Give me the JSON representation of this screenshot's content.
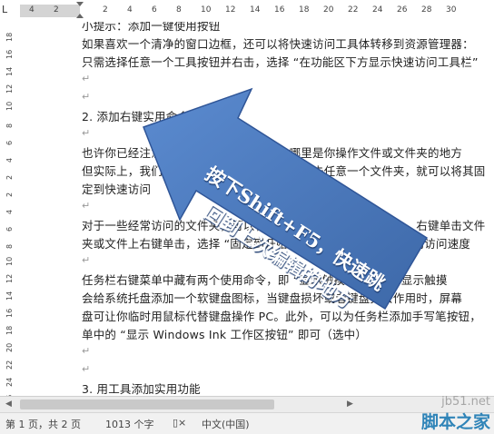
{
  "ruler": {
    "corner": "L",
    "top_numbers": [
      "4",
      "2",
      "",
      "2",
      "4",
      "6",
      "8",
      "10",
      "12",
      "14",
      "16",
      "18",
      "20",
      "22",
      "24",
      "26",
      "28",
      "30"
    ],
    "left_numbers": [
      "18",
      "16",
      "14",
      "12",
      "10",
      "8",
      "6",
      "4",
      "2",
      "2",
      "4",
      "6",
      "8",
      "10",
      "12",
      "14",
      "16",
      "18",
      "20",
      "22",
      "24",
      "26",
      "28",
      "30",
      "32",
      "34"
    ]
  },
  "document": {
    "lines": [
      "小提示：添加一键使用按钮",
      "如果喜欢一个清净的窗口边框，还可以将快速访问工具体转移到资源管理器：",
      "只需选择任意一个工具按钮并右击，选择 “在功能区下方显示快速访问工具栏”",
      "",
      "",
      "2. 添加右键实用命令",
      "",
      "也许你已经注意到了这个快速访问菜单，哪里是你操作文件或文件夹的地方",
      "但实际上，我们可以将它固定在这里。右键单击任意一个文件夹，就可以将其固",
      "定到快速访问",
      "",
      "对于一些经常访问的文件夹，可以将它们添加到开始屏幕菜单中。右键单击文件",
      "夹或文件上右键单击，选择 “固定到开始屏幕” 以增加常用文件夹的访问速度",
      "",
      "任务栏右键菜单中藏有两个使用命令，即 “显示触摸键盘按钮” 显示触摸",
      "会给系统托盘添加一个软键盘图标，当键盘损坏或者键盘失去作用时，屏幕",
      "盘可让你临时用鼠标代替键盘操作 PC。此外，可以为任务栏添加手写笔按钮，",
      "单中的 “显示 Windows Ink 工作区按钮” 即可（选中）",
      "",
      "",
      "3. 用工具添加实用功能"
    ],
    "para_mark": "↵"
  },
  "callout": {
    "line1": "按下Shift+F5，快速跳",
    "line2": "回到上次编辑的地方",
    "color": "#4a78bf"
  },
  "statusbar": {
    "page": "第 1 页，共 2 页",
    "words": "1013 个字",
    "language": "中文(中国)"
  },
  "watermark": {
    "site": "jb51.net",
    "name": "脚本之家"
  }
}
